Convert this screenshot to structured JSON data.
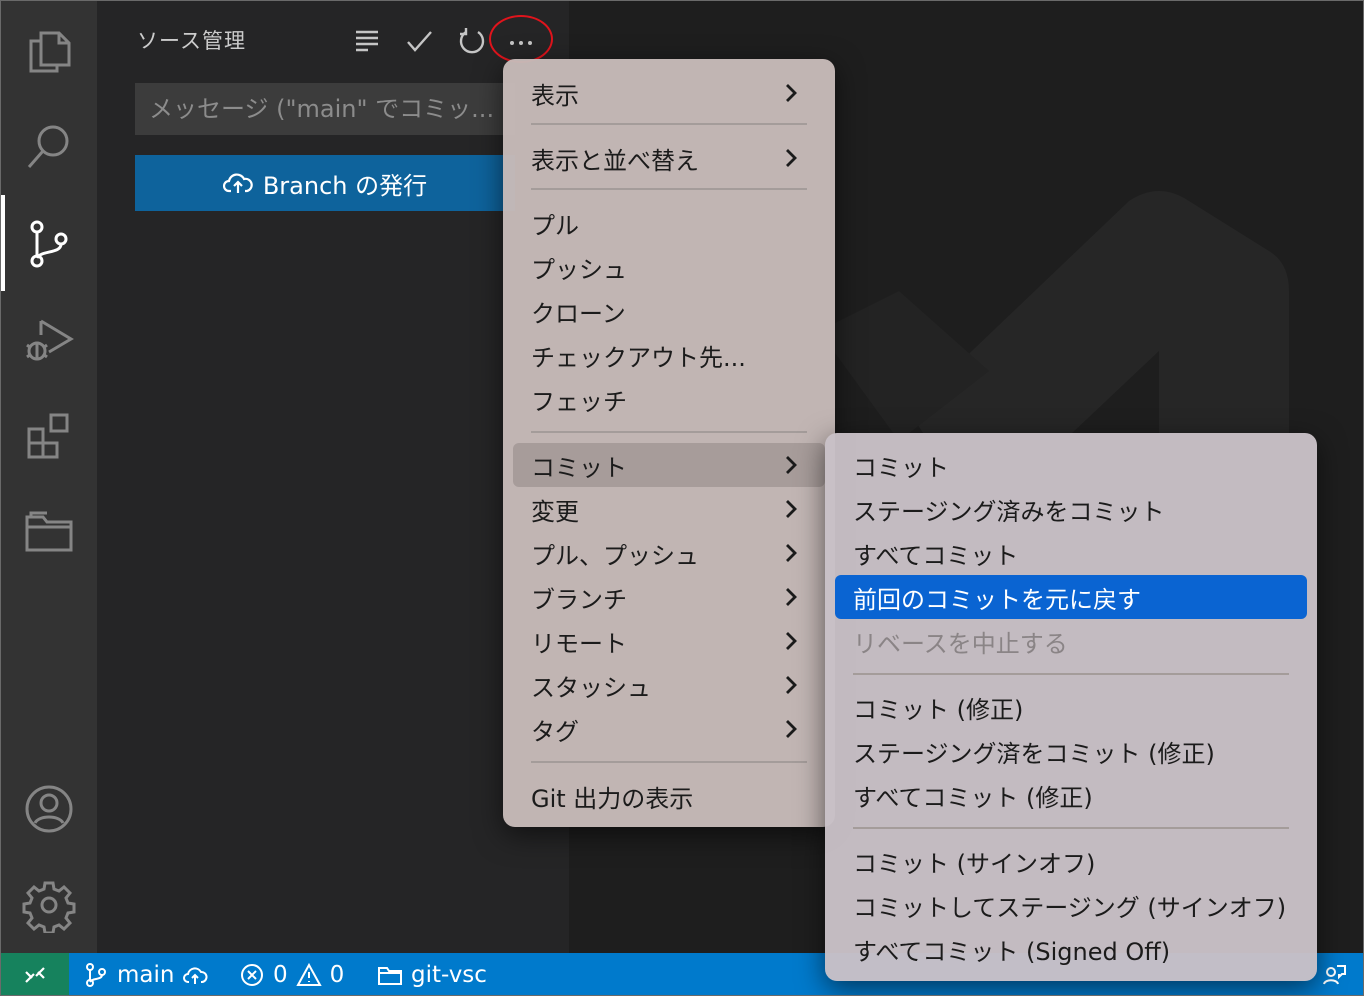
{
  "activity_bar": {
    "icons": [
      "explorer-icon",
      "search-icon",
      "source-control-icon",
      "run-debug-icon",
      "extensions-icon",
      "folder-icon",
      "account-icon",
      "settings-gear-icon"
    ],
    "active": "source-control-icon"
  },
  "sidebar": {
    "title": "ソース管理",
    "toolbar": [
      "view-list-icon",
      "check-icon",
      "refresh-icon",
      "more-actions-icon"
    ],
    "message_placeholder": "メッセージ (\"main\" でコミッ...",
    "publish_button": "Branch の発行"
  },
  "main_menu": {
    "items": [
      {
        "label": "表示",
        "submenu": true
      },
      {
        "label": "表示と並べ替え",
        "submenu": true
      },
      {
        "label": "プル",
        "submenu": false
      },
      {
        "label": "プッシュ",
        "submenu": false
      },
      {
        "label": "クローン",
        "submenu": false
      },
      {
        "label": "チェックアウト先...",
        "submenu": false
      },
      {
        "label": "フェッチ",
        "submenu": false
      },
      {
        "label": "コミット",
        "submenu": true,
        "state": "hover"
      },
      {
        "label": "変更",
        "submenu": true
      },
      {
        "label": "プル、プッシュ",
        "submenu": true
      },
      {
        "label": "ブランチ",
        "submenu": true
      },
      {
        "label": "リモート",
        "submenu": true
      },
      {
        "label": "スタッシュ",
        "submenu": true
      },
      {
        "label": "タグ",
        "submenu": true
      },
      {
        "label": "Git 出力の表示",
        "submenu": false
      }
    ]
  },
  "commit_submenu": {
    "items": [
      {
        "label": "コミット"
      },
      {
        "label": "ステージング済みをコミット"
      },
      {
        "label": "すべてコミット"
      },
      {
        "label": "前回のコミットを元に戻す",
        "state": "selected"
      },
      {
        "label": "リベースを中止する",
        "state": "disabled"
      },
      {
        "label": "コミット (修正)"
      },
      {
        "label": "ステージング済をコミット (修正)"
      },
      {
        "label": "すべてコミット (修正)"
      },
      {
        "label": "コミット (サインオフ)"
      },
      {
        "label": "コミットしてステージング (サインオフ)"
      },
      {
        "label": "すべてコミット (Signed Off)"
      }
    ]
  },
  "status_bar": {
    "branch": "main",
    "errors": "0",
    "warnings": "0",
    "folder": "git-vsc",
    "colors": {
      "bar": "#007acc",
      "remote": "#16825d"
    }
  }
}
